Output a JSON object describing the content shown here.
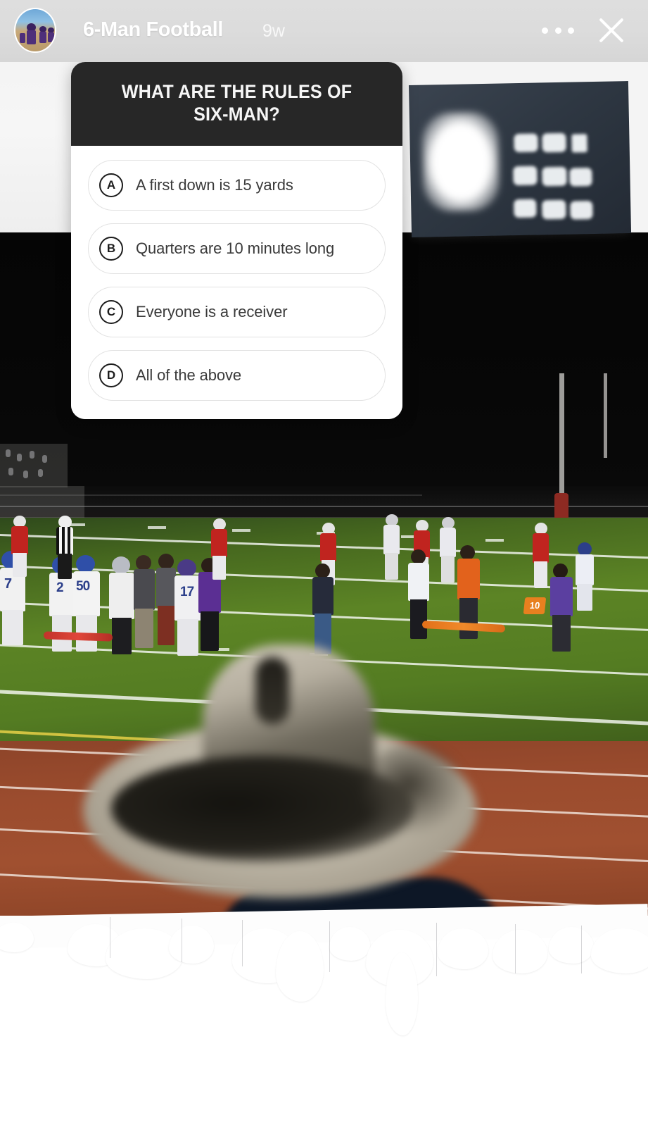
{
  "header": {
    "account_name": "6-Man Football",
    "time_ago": "9w",
    "avatar_name": "profile-avatar",
    "more_icon": "ellipsis-icon",
    "close_icon": "close-icon"
  },
  "quiz": {
    "question": "What are the rules of six-man?",
    "options": [
      {
        "letter": "A",
        "text": "A first down is 15 yards"
      },
      {
        "letter": "B",
        "text": "Quarters are 10 minutes long"
      },
      {
        "letter": "C",
        "text": "Everyone is a receiver"
      },
      {
        "letter": "D",
        "text": "All of the above"
      }
    ]
  },
  "photo": {
    "yard_marker_value": "10",
    "jersey_numbers": [
      "7",
      "2",
      "50",
      "17"
    ]
  },
  "colors": {
    "header_bar": "#dcdcdc",
    "question_bg": "#272727",
    "card_bg": "#ffffff",
    "option_border": "#e2e2e2",
    "field_green": "#5c8425",
    "track_red": "#9b4c2e",
    "marker_orange": "#e8801f"
  }
}
